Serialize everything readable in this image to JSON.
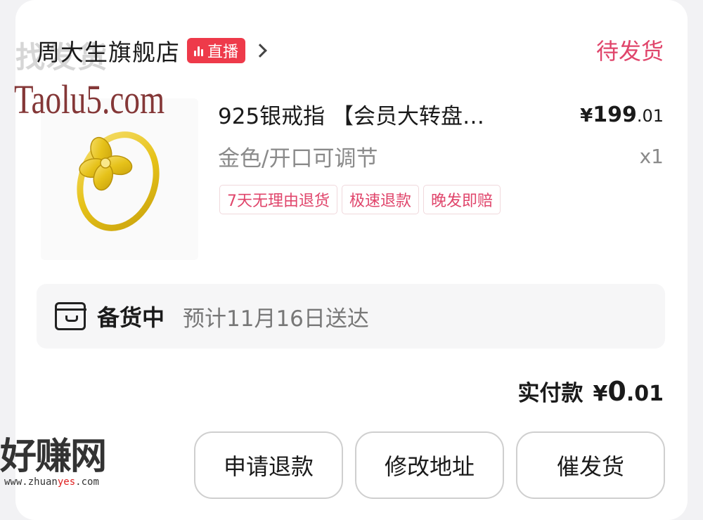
{
  "shop": {
    "name": "周大生旗舰店",
    "live_label": "直播",
    "order_status": "待发货"
  },
  "watermarks": {
    "top_text": "找发货",
    "site": "Taolu5.com"
  },
  "product": {
    "image": "gold-ring-image",
    "title": "925银戒指 【会员大转盘…",
    "price_currency": "¥",
    "price_int": "199",
    "price_dec": ".01",
    "spec": "金色/开口可调节",
    "quantity": "x1",
    "tags": [
      "7天无理由退货",
      "极速退款",
      "晚发即赔"
    ]
  },
  "shipping": {
    "icon": "package-box-icon",
    "status": "备货中",
    "eta": "预计11月16日送达"
  },
  "payment": {
    "label": "实付款",
    "currency": "¥",
    "amount_int": "0",
    "amount_dec": ".01"
  },
  "actions": {
    "refund": "申请退款",
    "change_address": "修改地址",
    "urge_shipping": "催发货"
  },
  "brand_logo": {
    "main": "好赚网",
    "url_prefix": "www.zhuan",
    "url_highlight": "yes",
    "url_suffix": ".com"
  },
  "colors": {
    "status_pink": "#e0456b",
    "live_red": "#ee3a4a",
    "gold": "#e6c21a"
  }
}
